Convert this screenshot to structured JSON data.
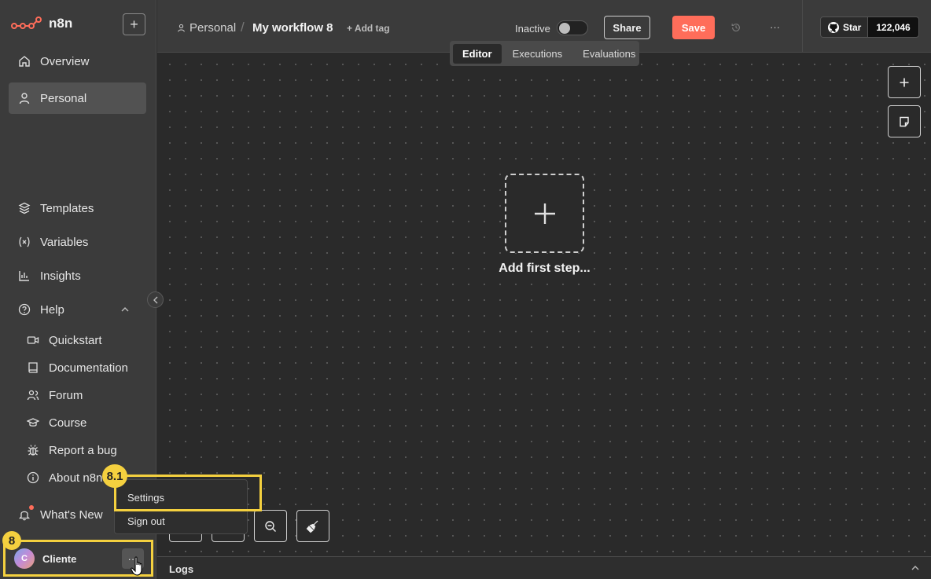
{
  "app": {
    "name": "n8n"
  },
  "sidebar": {
    "nav": [
      {
        "label": "Overview",
        "icon": "home-icon"
      },
      {
        "label": "Personal",
        "icon": "user-icon",
        "active": true
      }
    ],
    "secondary": [
      {
        "label": "Templates",
        "icon": "box-icon"
      },
      {
        "label": "Variables",
        "icon": "variable-icon"
      },
      {
        "label": "Insights",
        "icon": "chart-icon"
      },
      {
        "label": "Help",
        "icon": "help-circle-icon"
      }
    ],
    "help_items": [
      {
        "label": "Quickstart",
        "icon": "video-icon"
      },
      {
        "label": "Documentation",
        "icon": "book-icon"
      },
      {
        "label": "Forum",
        "icon": "users-icon"
      },
      {
        "label": "Course",
        "icon": "graduation-icon"
      },
      {
        "label": "Report a bug",
        "icon": "bug-icon"
      },
      {
        "label": "About n8n",
        "icon": "info-icon"
      }
    ],
    "whats_new": "What's New",
    "user": {
      "initial": "C",
      "name": "Cliente",
      "more": "···"
    }
  },
  "user_menu": {
    "items": [
      "Settings",
      "Sign out"
    ]
  },
  "annotations": {
    "badge_user": "8",
    "badge_settings": "8.1"
  },
  "topbar": {
    "breadcrumb_project": "Personal",
    "separator": "/",
    "workflow_name": "My workflow 8",
    "add_tag": "+ Add tag",
    "status": "Inactive",
    "share": "Share",
    "save": "Save",
    "more": "···",
    "github_star": "Star",
    "github_count": "122,046"
  },
  "tabs": [
    "Editor",
    "Executions",
    "Evaluations"
  ],
  "canvas": {
    "add_first_step": "Add first step..."
  },
  "logs": {
    "label": "Logs"
  },
  "colors": {
    "accent": "#ff6d5a",
    "highlight": "#f4d03f"
  }
}
